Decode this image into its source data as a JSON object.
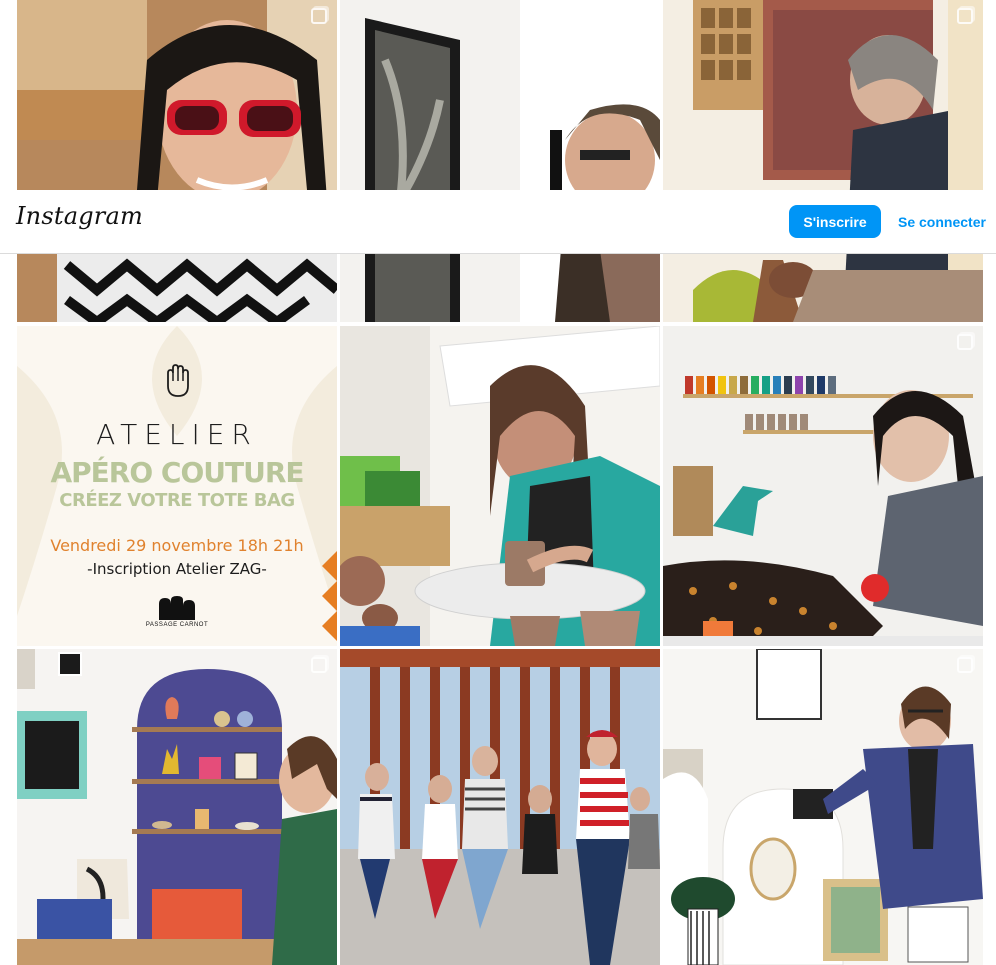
{
  "header": {
    "logo": "Instagram",
    "signup_label": "S'inscrire",
    "login_label": "Se connecter",
    "accent": "#0095f6"
  },
  "poster": {
    "title": "ATELIER",
    "subtitle_line1": "APÉRO COUTURE",
    "subtitle_line2": "CRÉEZ VOTRE TOTE BAG",
    "date": "Vendredi 29 novembre 18h 21h",
    "inscription": "-Inscription Atelier ZAG-",
    "brand": "PASSAGE CARNOT"
  },
  "tiles": [
    {
      "name": "post-selfie-sunglasses",
      "icon": "carousel-icon"
    },
    {
      "name": "post-man-looking-at-photo",
      "icon": "carousel-icon"
    },
    {
      "name": "post-woman-at-workshop",
      "icon": "carousel-icon"
    },
    {
      "name": "post-atelier-apero-couture-poster",
      "icon": ""
    },
    {
      "name": "post-pottery-wheel",
      "icon": "carousel-icon"
    },
    {
      "name": "post-sewing-workshop",
      "icon": "carousel-icon"
    },
    {
      "name": "post-shop-shelves",
      "icon": "carousel-icon"
    },
    {
      "name": "post-street-dancers",
      "icon": ""
    },
    {
      "name": "post-woman-arranging-display",
      "icon": "carousel-icon"
    }
  ]
}
